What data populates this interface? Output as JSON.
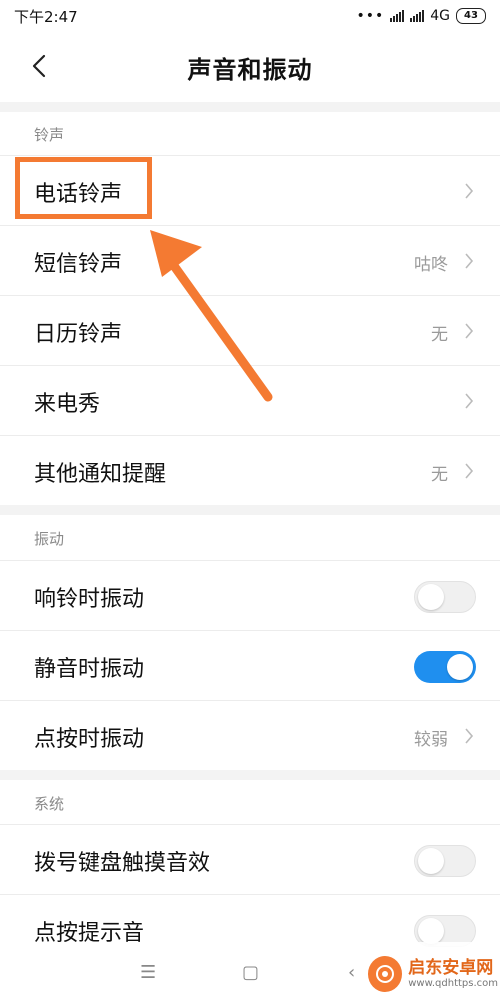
{
  "status_bar": {
    "time": "下午2:47",
    "network": "4G",
    "battery": "43"
  },
  "header": {
    "title": "声音和振动"
  },
  "sections": {
    "ringtones": {
      "header": "铃声",
      "items": [
        {
          "label": "电话铃声",
          "value": ""
        },
        {
          "label": "短信铃声",
          "value": "咕咚"
        },
        {
          "label": "日历铃声",
          "value": "无"
        },
        {
          "label": "来电秀",
          "value": ""
        },
        {
          "label": "其他通知提醒",
          "value": "无"
        }
      ]
    },
    "vibration": {
      "header": "振动",
      "items": [
        {
          "label": "响铃时振动",
          "toggle": "off"
        },
        {
          "label": "静音时振动",
          "toggle": "on"
        },
        {
          "label": "点按时振动",
          "value": "较弱"
        }
      ]
    },
    "system": {
      "header": "系统",
      "items": [
        {
          "label": "拨号键盘触摸音效",
          "toggle": "off"
        },
        {
          "label": "点按提示音",
          "toggle": "off"
        }
      ]
    }
  },
  "watermark": {
    "name": "启东安卓网",
    "url": "www.qdhttps.com"
  },
  "colors": {
    "accent": "#1f8fef",
    "annotation": "#f47a32"
  },
  "icons": [
    "back-icon",
    "chevron-right-icon",
    "menu-icon",
    "home-icon",
    "back-nav-icon"
  ]
}
